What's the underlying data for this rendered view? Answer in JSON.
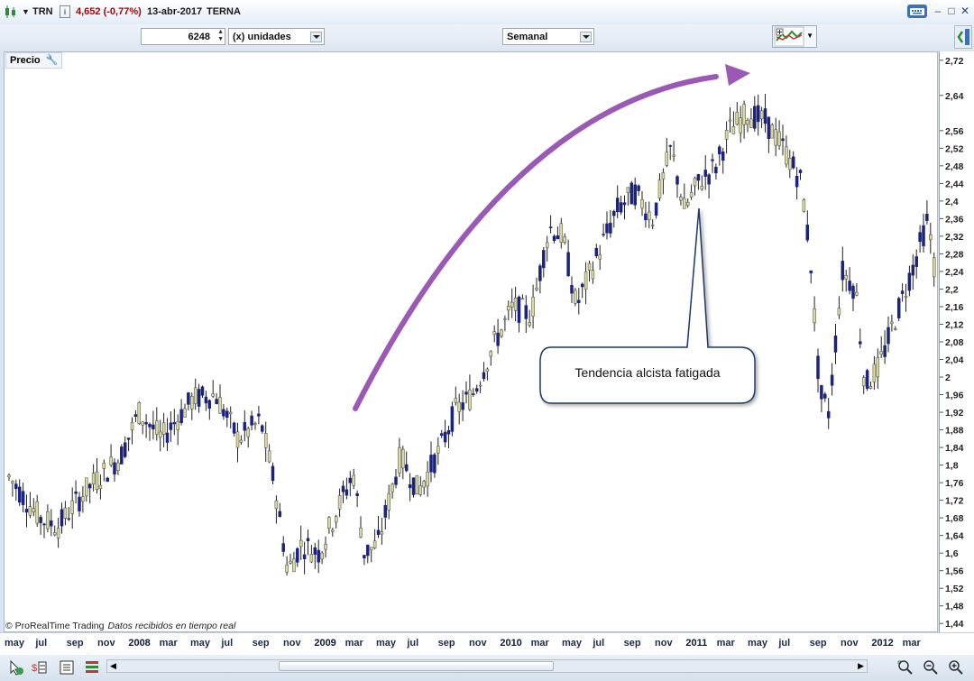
{
  "titlebar": {
    "symbol": "TRN",
    "price_change": "4,652 (-0,77%)",
    "date": "13-abr-2017",
    "name": "TERNA"
  },
  "toolbar": {
    "quantity": "6248",
    "units": "(x) unidades",
    "period": "Semanal"
  },
  "chart": {
    "panel_label": "Precio",
    "copyright": "© ProRealTime Trading",
    "status": "Datos recibidos en tiempo real",
    "annotation": "Tendencia alcista fatigada"
  },
  "chart_data": {
    "type": "candlestick",
    "yticks": [
      "2,72",
      "2,64",
      "2,56",
      "2,52",
      "2,48",
      "2,44",
      "2,4",
      "2,36",
      "2,32",
      "2,28",
      "2,24",
      "2,2",
      "2,16",
      "2,12",
      "2,08",
      "2,04",
      "2",
      "1,96",
      "1,92",
      "1,88",
      "1,84",
      "1,8",
      "1,76",
      "1,72",
      "1,68",
      "1,64",
      "1,6",
      "1,56",
      "1,52",
      "1,48",
      "1,44"
    ],
    "xticks": [
      "may",
      "jul",
      "sep",
      "nov",
      "2008",
      "mar",
      "may",
      "jul",
      "sep",
      "nov",
      "2009",
      "mar",
      "may",
      "jul",
      "sep",
      "nov",
      "2010",
      "mar",
      "may",
      "jul",
      "sep",
      "nov",
      "2011",
      "mar",
      "may",
      "jul",
      "sep",
      "nov",
      "2012",
      "mar"
    ],
    "ylim": [
      1.42,
      2.74
    ],
    "trend_path": [
      [
        1.84,
        2.0
      ],
      [
        2.2,
        2.4
      ],
      [
        2.56,
        2.68
      ],
      [
        2.68,
        2.7
      ]
    ],
    "colors": {
      "up": "#d9d9a0",
      "down": "#1a237e",
      "wick": "#222222",
      "arrow": "#9b59b6"
    }
  },
  "icons": [
    "candles-icon",
    "info-icon",
    "keyboard-icon",
    "minimize-icon",
    "maximize-icon",
    "close-icon",
    "indicator-icon",
    "side-panel-icon",
    "cursor-icon",
    "drawing-icon",
    "list-icon",
    "bars-icon",
    "scroll-left-icon",
    "scroll-right-icon",
    "zoom-fit-icon",
    "zoom-out-icon",
    "zoom-in-icon"
  ]
}
